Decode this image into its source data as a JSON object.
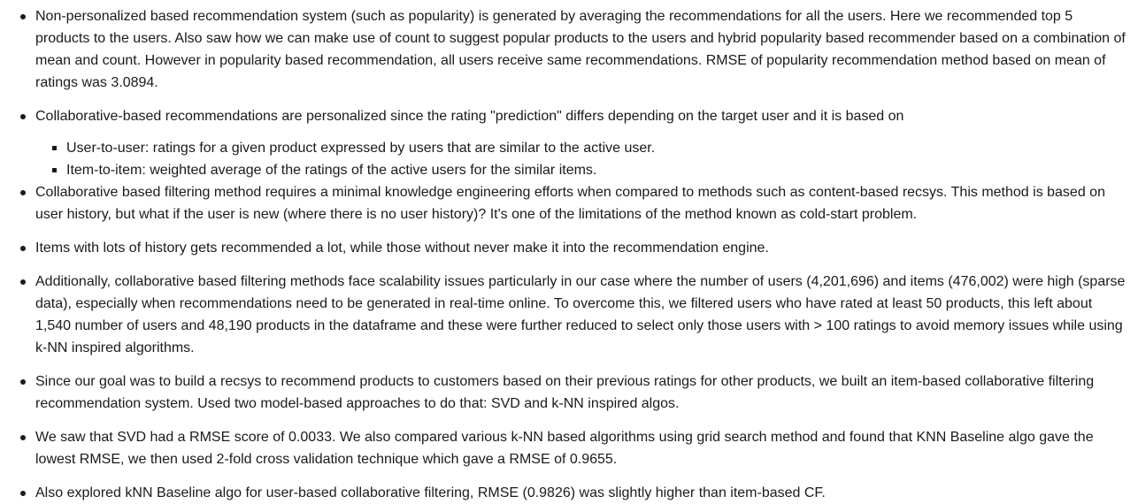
{
  "bullets": [
    "Non-personalized based recommendation system (such as popularity) is generated by averaging the recommendations for all the users. Here we recommended top 5 products to the users. Also saw how we can make use of count to suggest popular products to the users and hybrid popularity based recommender based on a combination of mean and count. However in popularity based recommendation, all users receive same recommendations. RMSE of popularity recommendation method based on mean of ratings was 3.0894.",
    "Collaborative-based recommendations are personalized since the rating \"prediction\" differs depending on the target user and it is based on",
    "Collaborative based filtering method requires a minimal knowledge engineering efforts when compared to methods such as content-based recsys. This method is based on user history, but what if the user is new (where there is no user history)? It's one of the limitations of the method known as cold-start problem.",
    "Items with lots of history gets recommended a lot, while those without never make it into the recommendation engine.",
    "Additionally, collaborative based filtering methods face scalability issues particularly in our case where the number of users (4,201,696) and items (476,002) were high (sparse data), especially when recommendations need to be generated in real-time online. To overcome this, we filtered users who have rated at least 50 products, this left about 1,540 number of users and 48,190 products in the dataframe and these were further reduced to select only those users with > 100 ratings to avoid memory issues while using k-NN inspired algorithms.",
    "Since our goal was to build a recsys to recommend products to customers based on their previous ratings for other products, we built an item-based collaborative filtering recommendation system. Used two model-based approaches to do that: SVD and k-NN inspired algos.",
    "We saw that SVD had a RMSE score of 0.0033. We also compared various k-NN based algorithms using grid search method and found that KNN Baseline algo gave the lowest RMSE, we then used 2-fold cross validation technique which gave a RMSE of 0.9655.",
    "Also explored kNN Baseline algo for user-based collaborative filtering, RMSE (0.9826) was slightly higher than item-based CF."
  ],
  "sub_bullets": [
    "User-to-user: ratings for a given product expressed by users that are similar to the active user.",
    "Item-to-item: weighted average of the ratings of the active users for the similar items."
  ]
}
